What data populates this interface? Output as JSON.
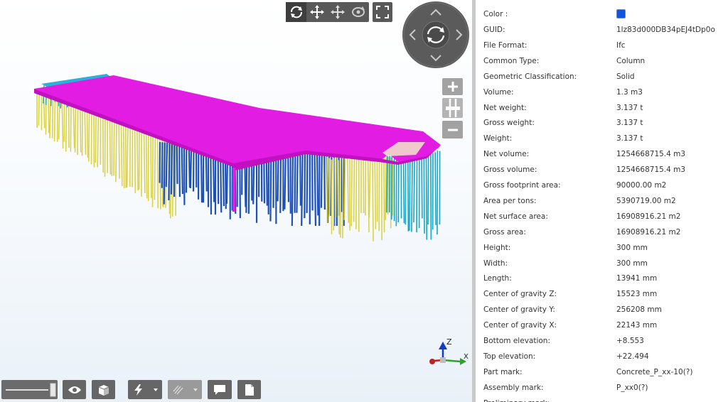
{
  "view_toolbar": {
    "buttons": [
      "rotate-icon",
      "pan-icon",
      "move-icon",
      "orbit-icon",
      "fullscreen-icon"
    ]
  },
  "navigation": {
    "directions": [
      "up",
      "down",
      "left",
      "right"
    ],
    "zoom": [
      "plus-icon",
      "slider-icon",
      "minus-icon"
    ]
  },
  "axis_gizmo": {
    "z_label": "Z",
    "x_label": "X"
  },
  "bottom_toolbar": {
    "buttons": [
      "slider-icon",
      "eye-icon",
      "box-icon",
      "lightning-icon",
      "hatch-icon",
      "comment-icon",
      "document-icon"
    ]
  },
  "model_colors": {
    "slab": "#e21ce2",
    "columns_blue": "#1d50b8",
    "columns_yellow": "#d9d24a",
    "columns_cyan": "#1aa3c4",
    "beam_cyan": "#29b1d8"
  },
  "properties": {
    "color_label": "Color :",
    "color_value": "#1155dd",
    "rows": [
      {
        "label": "GUID:",
        "value": "1lz83d000DB34pEJ4tDp0o"
      },
      {
        "label": "File Format:",
        "value": "Ifc"
      },
      {
        "label": "Common Type:",
        "value": "Column"
      },
      {
        "label": "Geometric Classification:",
        "value": "Solid"
      },
      {
        "label": "Volume:",
        "value": "1.3 m3"
      },
      {
        "label": "Net weight:",
        "value": "3.137 t"
      },
      {
        "label": "Gross weight:",
        "value": "3.137 t"
      },
      {
        "label": "Weight:",
        "value": "3.137 t"
      },
      {
        "label": "Net volume:",
        "value": "1254668715.4 m3"
      },
      {
        "label": "Gross volume:",
        "value": "1254668715.4 m3"
      },
      {
        "label": "Gross footprint area:",
        "value": "90000.00 m2"
      },
      {
        "label": "Area per tons:",
        "value": "5390719.00 m2"
      },
      {
        "label": "Net surface area:",
        "value": "16908916.21 m2"
      },
      {
        "label": "Gross area:",
        "value": "16908916.21 m2"
      },
      {
        "label": "Height:",
        "value": "300 mm"
      },
      {
        "label": "Width:",
        "value": "300 mm"
      },
      {
        "label": "Length:",
        "value": "13941 mm"
      },
      {
        "label": "Center of gravity Z:",
        "value": "15523 mm"
      },
      {
        "label": "Center of gravity Y:",
        "value": "256208 mm"
      },
      {
        "label": "Center of gravity X:",
        "value": "22143 mm"
      },
      {
        "label": "Bottom elevation:",
        "value": "+8.553"
      },
      {
        "label": "Top elevation:",
        "value": "+22.494"
      },
      {
        "label": "Part mark:",
        "value": "Concrete_P_xx-10(?)"
      },
      {
        "label": "Assembly mark:",
        "value": "P_xx0(?)"
      },
      {
        "label": "Preliminary mark:",
        "value": ""
      }
    ]
  }
}
